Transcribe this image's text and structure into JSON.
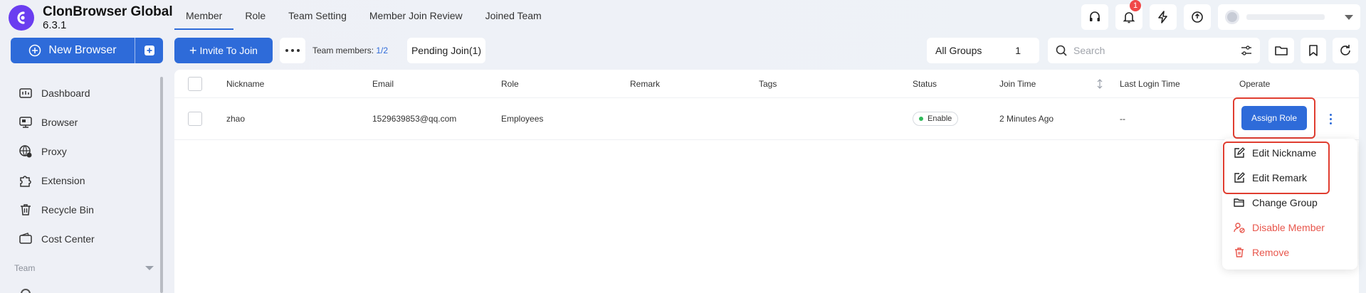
{
  "app": {
    "name": "ClonBrowser Global",
    "version": "6.3.1"
  },
  "sidebar": {
    "new_browser_label": "New Browser",
    "items": [
      {
        "label": "Dashboard",
        "icon": "dashboard-icon"
      },
      {
        "label": "Browser",
        "icon": "browser-icon"
      },
      {
        "label": "Proxy",
        "icon": "globe-icon"
      },
      {
        "label": "Extension",
        "icon": "puzzle-icon"
      },
      {
        "label": "Recycle Bin",
        "icon": "trash-icon"
      },
      {
        "label": "Cost Center",
        "icon": "wallet-icon"
      }
    ],
    "section_label": "Team"
  },
  "tabs": [
    {
      "label": "Member",
      "active": true
    },
    {
      "label": "Role",
      "active": false
    },
    {
      "label": "Team Setting",
      "active": false
    },
    {
      "label": "Member Join Review",
      "active": false
    },
    {
      "label": "Joined Team",
      "active": false
    }
  ],
  "header": {
    "notification_count": "1"
  },
  "toolbar": {
    "invite_label": "Invite To Join",
    "team_members_label": "Team members:",
    "team_members_count": "1/2",
    "pending_label": "Pending Join(1)",
    "group_label": "All Groups",
    "group_count": "1",
    "search_placeholder": "Search"
  },
  "table": {
    "columns": [
      "Nickname",
      "Email",
      "Role",
      "Remark",
      "Tags",
      "Status",
      "Join Time",
      "Last Login Time",
      "Operate"
    ],
    "rows": [
      {
        "nickname": "zhao",
        "email": "1529639853@qq.com",
        "role": "Employees",
        "remark": "",
        "tags": "",
        "status": "Enable",
        "join_time": "2 Minutes Ago",
        "last_login": "--",
        "action_label": "Assign Role"
      }
    ]
  },
  "menu": {
    "items": [
      {
        "label": "Edit Nickname",
        "danger": false
      },
      {
        "label": "Edit Remark",
        "danger": false
      },
      {
        "label": "Change Group",
        "danger": false
      },
      {
        "label": "Disable Member",
        "danger": true
      },
      {
        "label": "Remove",
        "danger": true
      }
    ]
  },
  "colors": {
    "accent": "#2e6bd9",
    "brand": "#6a3df0",
    "danger": "#e8564c",
    "highlight": "#e03d30",
    "status_enabled": "#2fb95a"
  }
}
